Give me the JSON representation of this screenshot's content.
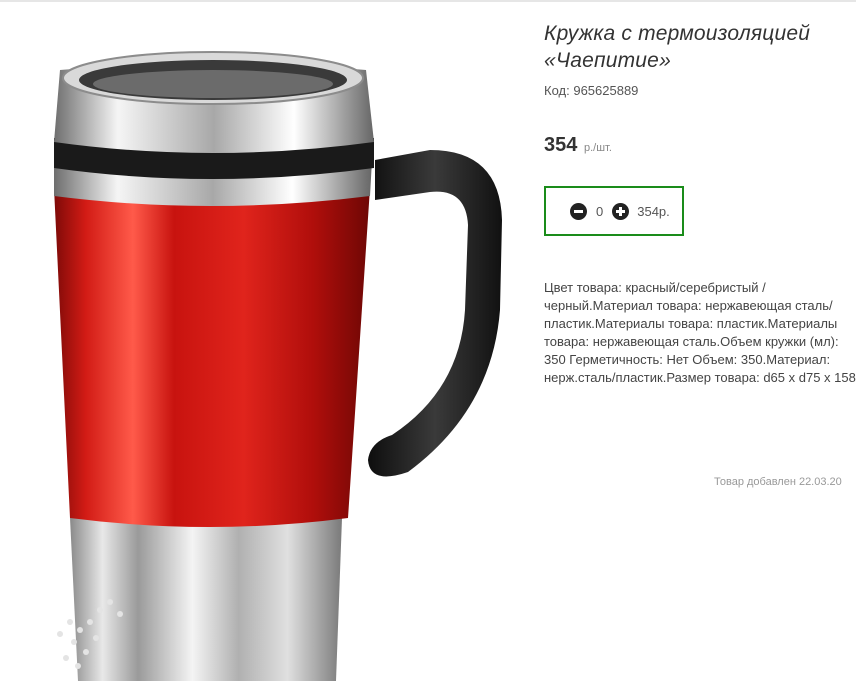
{
  "product": {
    "title": "Кружка с термоизоляцией «Чаепитие»",
    "code_label": "Код:",
    "code_value": "965625889",
    "price_value": "354",
    "price_unit": "р./шт.",
    "description": "Цвет товара: красный/серебристый /черный.Материал товара: нержавеющая сталь/пластик.Материалы товара: пластик.Материалы товара: нержавеющая сталь.Объем кружки (мл): 350 Герметичность: Нет Объем: 350.Материал: нерж.сталь/пластик.Размер товара: d65 x d75 x 158",
    "added_text": "Товар добавлен 22.03.20"
  },
  "cart": {
    "minus_icon": "minus-circle-icon",
    "plus_icon": "plus-circle-icon",
    "quantity": "0",
    "sum": "354р.",
    "accent_color": "#1a8c1a"
  },
  "image": {
    "subject": "red-silver-thermo-mug",
    "colors": {
      "body_red": "#d11a14",
      "steel": "#c8c8c8",
      "handle": "#1f1f1f"
    }
  }
}
